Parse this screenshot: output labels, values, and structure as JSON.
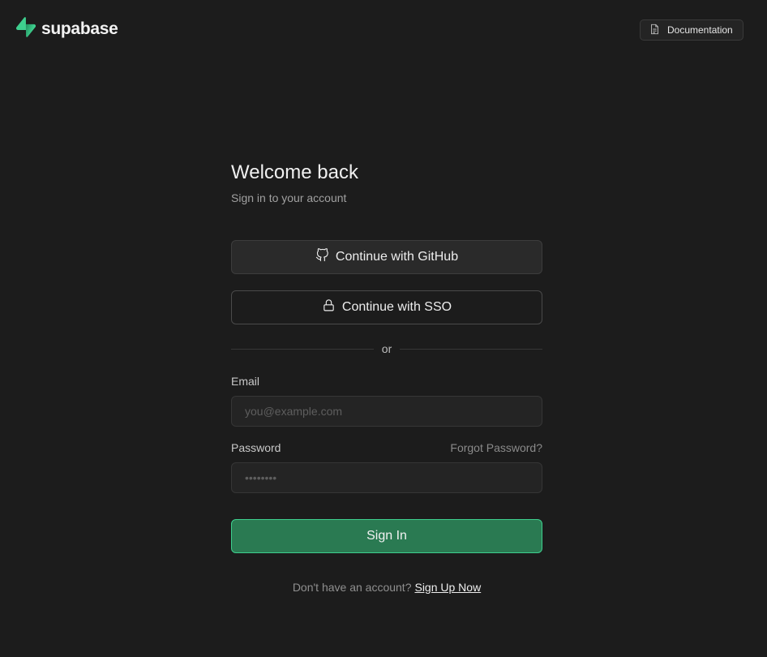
{
  "header": {
    "logo_text": "supabase",
    "logo_icon": "supabase-bolt-icon",
    "docs_label": "Documentation",
    "docs_icon": "document-icon"
  },
  "form": {
    "title": "Welcome back",
    "subtitle": "Sign in to your account",
    "github_label": "Continue with GitHub",
    "github_icon": "github-icon",
    "sso_label": "Continue with SSO",
    "sso_icon": "lock-icon",
    "divider_text": "or",
    "email_label": "Email",
    "email_placeholder": "you@example.com",
    "email_value": "",
    "password_label": "Password",
    "forgot_label": "Forgot Password?",
    "password_placeholder": "••••••••",
    "password_value": "",
    "signin_label": "Sign In",
    "signup_prompt": "Don't have an account?",
    "signup_link": "Sign Up Now"
  },
  "colors": {
    "background": "#1c1c1c",
    "brand_green": "#3ecf8e",
    "signin_bg": "#2a7a52"
  }
}
